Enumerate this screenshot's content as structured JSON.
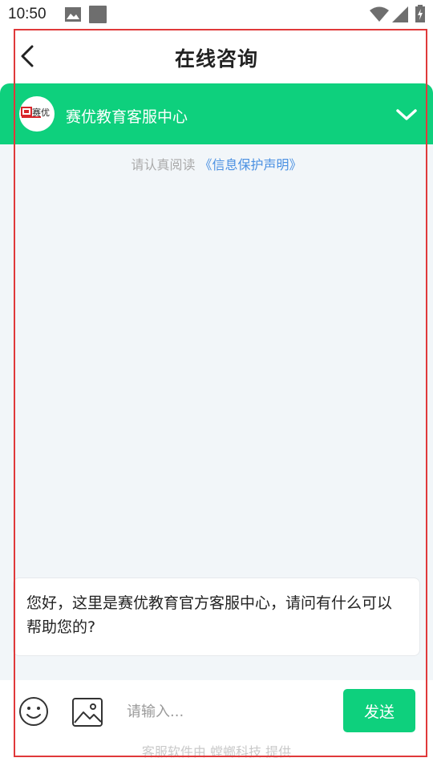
{
  "status_bar": {
    "time": "10:50",
    "icons": [
      "photo-icon",
      "square-icon",
      "wifi-icon",
      "signal-icon",
      "battery-icon"
    ]
  },
  "header": {
    "title": "在线咨询",
    "back_icon": "chevron-left-icon"
  },
  "service": {
    "name": "赛优教育客服中心",
    "logo_text": "赛优",
    "collapse_icon": "chevron-down-icon",
    "color": "#0ed07d"
  },
  "chat": {
    "notice_text": "请认真阅读",
    "notice_link": "《信息保护声明》",
    "messages": [
      {
        "text": "您好，这里是赛优教育官方客服中心，请问有什么可以帮助您的?"
      }
    ]
  },
  "input_bar": {
    "placeholder": "请输入...",
    "send_label": "发送",
    "emoji_icon": "smiley-icon",
    "image_icon": "image-icon"
  },
  "footer": {
    "credit": "客服软件由 螳螂科技 提供"
  },
  "colors": {
    "accent": "#0ed07d",
    "link": "#4a90e2",
    "chat_bg": "#f2f6f9",
    "outline": "#e0393a"
  }
}
